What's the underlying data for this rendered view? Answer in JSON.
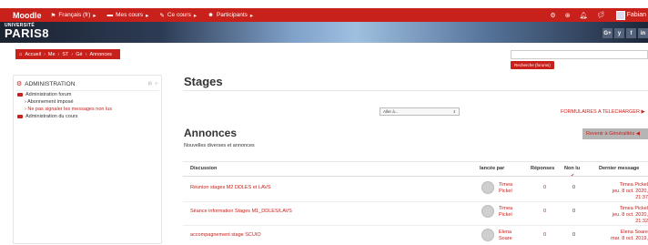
{
  "navbar": {
    "brand": "Moodle",
    "language": "Français (fr)",
    "my_courses": "Mes cours",
    "this_course": "Ce cours",
    "participants": "Participants",
    "notif_count": "2",
    "user": "Fabian"
  },
  "banner": {
    "logo_top": "UNIVERSITÉ",
    "logo_bottom": "PARIS8",
    "social": [
      "G+",
      "y",
      "f",
      "in"
    ]
  },
  "breadcrumb": [
    "Accueil",
    "Me",
    "ST",
    "Gé",
    "Annonces"
  ],
  "search": {
    "placeholder": "",
    "button": "Recherche (forums)"
  },
  "admin": {
    "title": "ADMINISTRATION",
    "forum_admin": "Administration forum",
    "subscription": "Abonnement imposé",
    "track": "Ne pas signaler les messages non lus",
    "course_admin": "Administration du cours"
  },
  "main": {
    "title": "Stages",
    "jump_to": "Aller à...",
    "forms_link": "FORMULAIRES A TELECHARGER ▶",
    "forum_title": "Annonces",
    "forum_desc": "Nouvelles diverses et annonces",
    "back_button": "Revenir à Généralités ◀"
  },
  "table": {
    "headers": {
      "discussion": "Discussion",
      "started_by": "lancée par",
      "replies": "Réponses",
      "unread": "Non lu",
      "last_post": "Dernier message"
    },
    "rows": [
      {
        "subject": "Réunion stages M2 DDLES et LAVS",
        "author_first": "Timea",
        "author_last": "Pickel",
        "replies": "0",
        "unread": "0",
        "last_name": "Timea Pickel",
        "last_date": "jeu. 8 oct. 2020,",
        "last_time": "21:37"
      },
      {
        "subject": "Séance information Stages M1_DDLES/LAVS",
        "author_first": "Timea",
        "author_last": "Pickel",
        "replies": "0",
        "unread": "0",
        "last_name": "Timea Pickel",
        "last_date": "jeu. 8 oct. 2020,",
        "last_time": "21:32"
      },
      {
        "subject": "accompagnement stage SCUIO",
        "author_first": "Elena",
        "author_last": "Soare",
        "replies": "0",
        "unread": "0",
        "last_name": "Elena Soare",
        "last_date": "mar. 8 oct. 2019,",
        "last_time": ""
      }
    ]
  },
  "colors": {
    "accent": "#c8201b"
  }
}
